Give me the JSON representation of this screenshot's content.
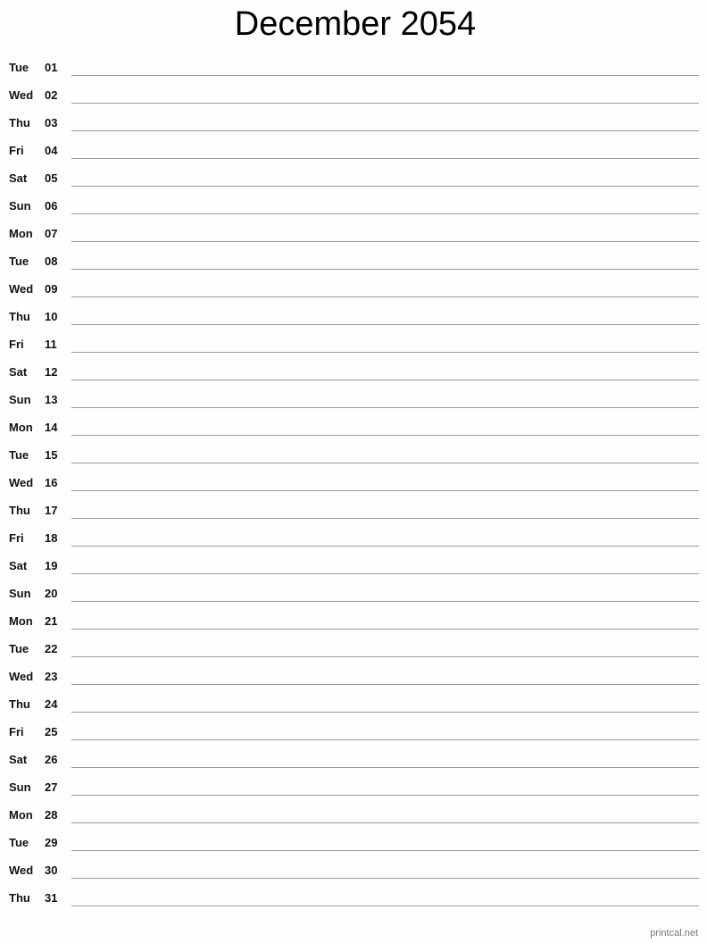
{
  "title": "December 2054",
  "days": [
    {
      "dow": "Tue",
      "num": "01"
    },
    {
      "dow": "Wed",
      "num": "02"
    },
    {
      "dow": "Thu",
      "num": "03"
    },
    {
      "dow": "Fri",
      "num": "04"
    },
    {
      "dow": "Sat",
      "num": "05"
    },
    {
      "dow": "Sun",
      "num": "06"
    },
    {
      "dow": "Mon",
      "num": "07"
    },
    {
      "dow": "Tue",
      "num": "08"
    },
    {
      "dow": "Wed",
      "num": "09"
    },
    {
      "dow": "Thu",
      "num": "10"
    },
    {
      "dow": "Fri",
      "num": "11"
    },
    {
      "dow": "Sat",
      "num": "12"
    },
    {
      "dow": "Sun",
      "num": "13"
    },
    {
      "dow": "Mon",
      "num": "14"
    },
    {
      "dow": "Tue",
      "num": "15"
    },
    {
      "dow": "Wed",
      "num": "16"
    },
    {
      "dow": "Thu",
      "num": "17"
    },
    {
      "dow": "Fri",
      "num": "18"
    },
    {
      "dow": "Sat",
      "num": "19"
    },
    {
      "dow": "Sun",
      "num": "20"
    },
    {
      "dow": "Mon",
      "num": "21"
    },
    {
      "dow": "Tue",
      "num": "22"
    },
    {
      "dow": "Wed",
      "num": "23"
    },
    {
      "dow": "Thu",
      "num": "24"
    },
    {
      "dow": "Fri",
      "num": "25"
    },
    {
      "dow": "Sat",
      "num": "26"
    },
    {
      "dow": "Sun",
      "num": "27"
    },
    {
      "dow": "Mon",
      "num": "28"
    },
    {
      "dow": "Tue",
      "num": "29"
    },
    {
      "dow": "Wed",
      "num": "30"
    },
    {
      "dow": "Thu",
      "num": "31"
    }
  ],
  "footer": "printcal.net"
}
